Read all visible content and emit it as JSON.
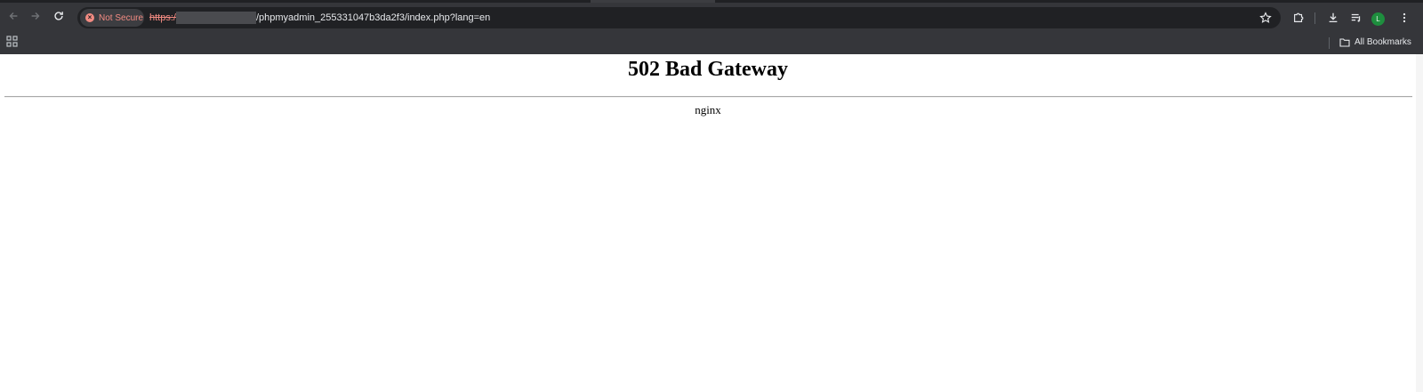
{
  "browser": {
    "security_chip": "Not Secure",
    "url": {
      "scheme": "https:/",
      "path": "/phpmyadmin_255331047b3da2f3/index.php?lang=en"
    },
    "bookmarks_bar": {
      "all_bookmarks_label": "All Bookmarks"
    },
    "profile_initial": "L"
  },
  "page": {
    "heading": "502 Bad Gateway",
    "server": "nginx"
  }
}
